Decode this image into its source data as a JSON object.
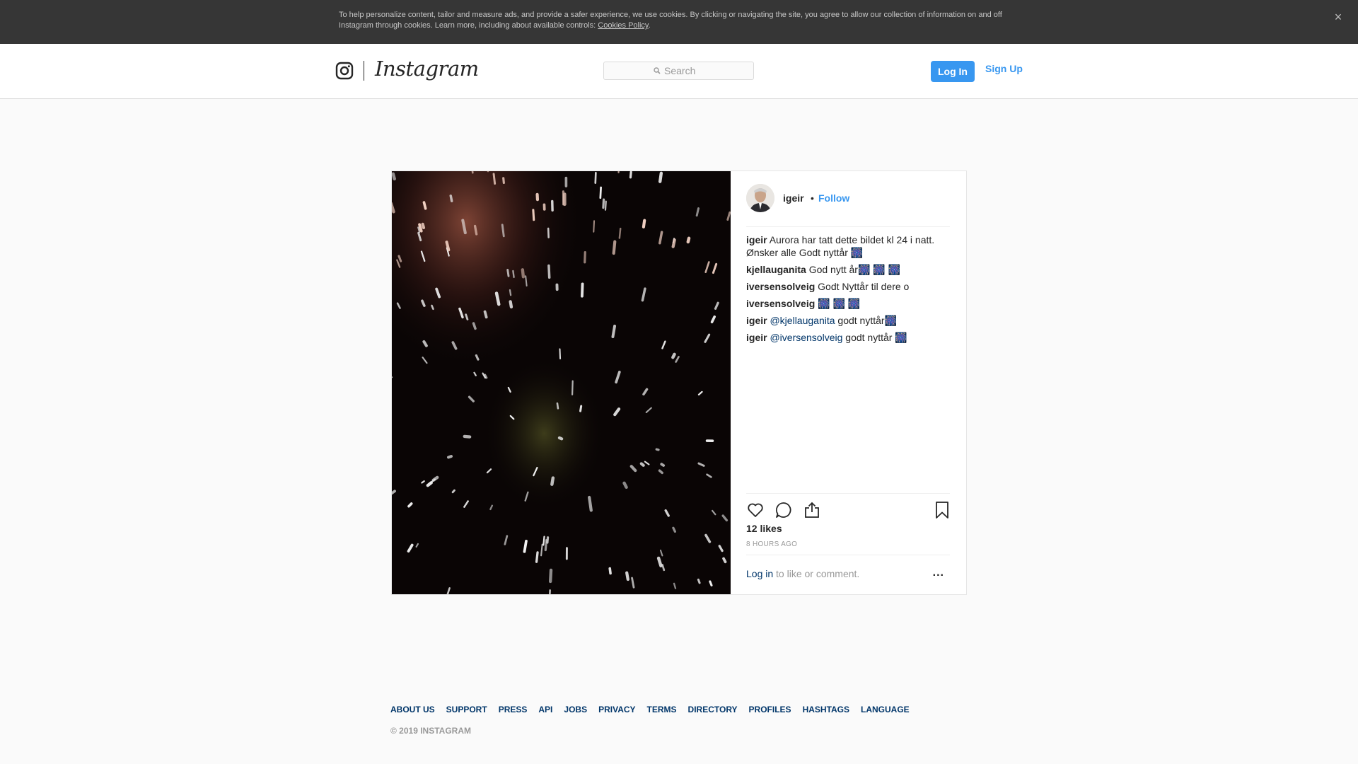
{
  "cookie_banner": {
    "text": "To help personalize content, tailor and measure ads, and provide a safer experience, we use cookies. By clicking or navigating the site, you agree to allow our collection of information on and off Instagram through cookies. Learn more, including about available controls: ",
    "link": "Cookies Policy",
    "after_link": ".",
    "close": "×"
  },
  "header": {
    "logo": "Instagram",
    "search_placeholder": "Search",
    "login": "Log In",
    "signup": "Sign Up"
  },
  "post": {
    "username": "igeir",
    "separator": "•",
    "follow": "Follow",
    "comments": [
      {
        "user": "igeir",
        "mention": "",
        "text": "Aurora har tatt dette bildet kl 24 i natt. Ønsker alle Godt nyttår 🎆"
      },
      {
        "user": "kjellauganita",
        "mention": "",
        "text": "God nytt år🎆 🎆 🎆"
      },
      {
        "user": "iversensolveig",
        "mention": "",
        "text": "Godt Nyttår til dere o"
      },
      {
        "user": "iversensolveig",
        "mention": "",
        "text": "🎆 🎆 🎆"
      },
      {
        "user": "igeir",
        "mention": "@kjellauganita",
        "text": "godt nyttår🎆"
      },
      {
        "user": "igeir",
        "mention": "@iversensolveig",
        "text": "godt nyttår 🎆"
      }
    ],
    "likes": "12 likes",
    "time": "8 HOURS AGO",
    "login_link": "Log in",
    "login_text": " to like or comment.",
    "more": "..."
  },
  "footer": {
    "links": [
      "ABOUT US",
      "SUPPORT",
      "PRESS",
      "API",
      "JOBS",
      "PRIVACY",
      "TERMS",
      "DIRECTORY",
      "PROFILES",
      "HASHTAGS",
      "LANGUAGE"
    ],
    "copyright": "© 2019 INSTAGRAM"
  },
  "icons": {
    "logo": "instagram-camera-icon",
    "search": "search-icon",
    "like": "heart-icon",
    "comment": "comment-icon",
    "share": "share-icon",
    "save": "bookmark-icon",
    "close": "close-icon"
  },
  "colors": {
    "accent": "#3897f0",
    "link_dark": "#003569",
    "banner_bg": "#363636"
  }
}
